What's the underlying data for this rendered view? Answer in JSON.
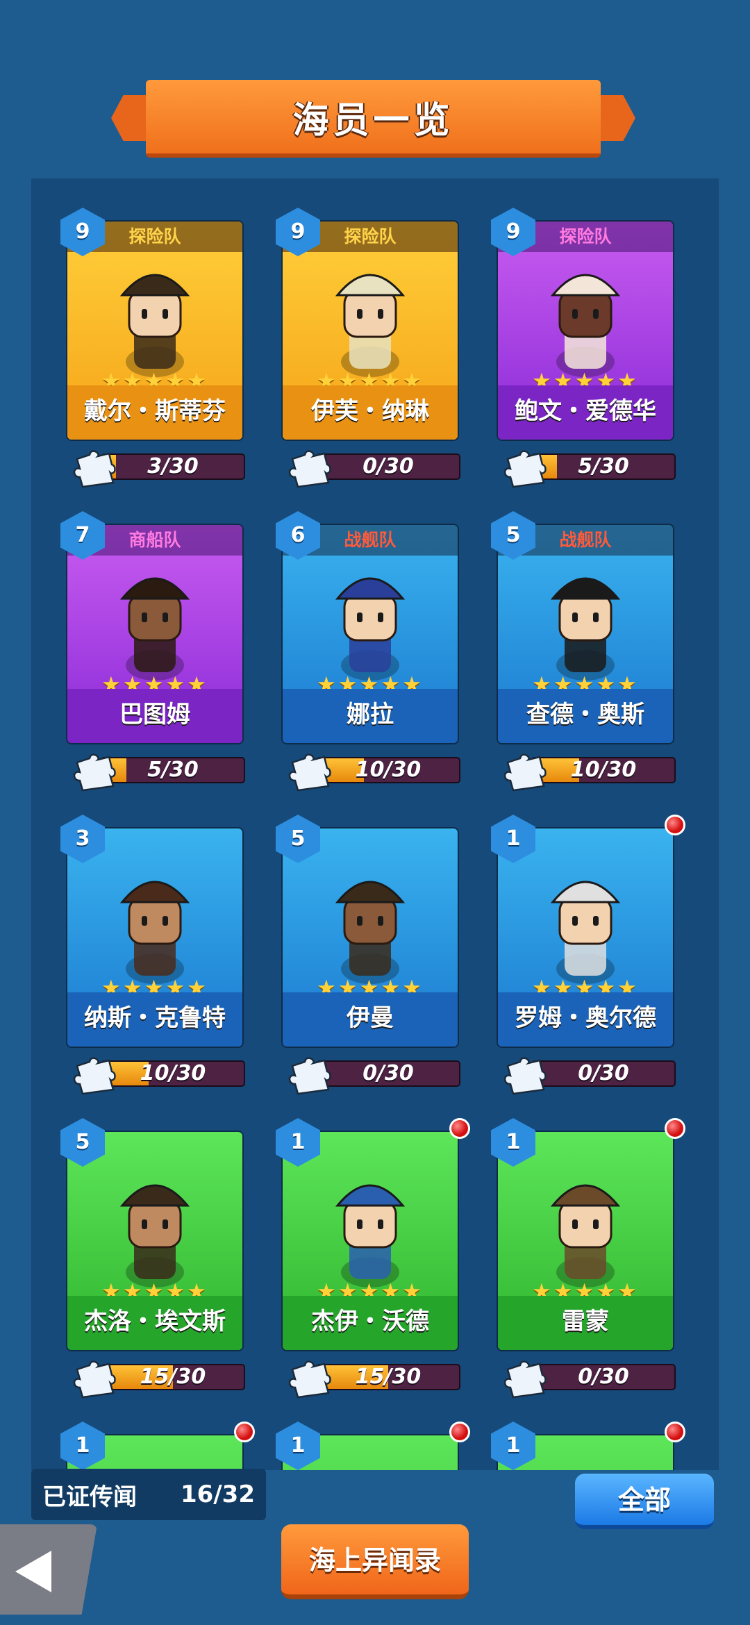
{
  "header": {
    "title": "海员一览"
  },
  "crew": [
    {
      "name": "戴尔・斯蒂芬",
      "level": "9",
      "team": "探险队",
      "progress_label": "3/30",
      "progress": 0.1,
      "color": "gold",
      "red_dot": false,
      "team_red": false,
      "hat": "#3a2a1a",
      "skin": "#f3d2b0"
    },
    {
      "name": "伊芙・纳琳",
      "level": "9",
      "team": "探险队",
      "progress_label": "0/30",
      "progress": 0.0,
      "color": "gold",
      "red_dot": false,
      "team_red": false,
      "hat": "#e8e2c0",
      "skin": "#f3d2b0"
    },
    {
      "name": "鲍文・爱德华",
      "level": "9",
      "team": "探险队",
      "progress_label": "5/30",
      "progress": 0.17,
      "color": "purple",
      "red_dot": false,
      "team_red": false,
      "hat": "#f3e6d8",
      "skin": "#6b3a2a"
    },
    {
      "name": "巴图姆",
      "level": "7",
      "team": "商船队",
      "progress_label": "5/30",
      "progress": 0.17,
      "color": "purple",
      "red_dot": false,
      "team_red": false,
      "hat": "#2a1a10",
      "skin": "#8a5a3a"
    },
    {
      "name": "娜拉",
      "level": "6",
      "team": "战舰队",
      "progress_label": "10/30",
      "progress": 0.33,
      "color": "blue",
      "red_dot": false,
      "team_red": true,
      "hat": "#2a3f9a",
      "skin": "#f3d2b0"
    },
    {
      "name": "查德・奥斯",
      "level": "5",
      "team": "战舰队",
      "progress_label": "10/30",
      "progress": 0.33,
      "color": "blue",
      "red_dot": false,
      "team_red": true,
      "hat": "#1a1a1a",
      "skin": "#f3d2b0"
    },
    {
      "name": "纳斯・克鲁特",
      "level": "3",
      "team": "",
      "progress_label": "10/30",
      "progress": 0.33,
      "color": "blue",
      "red_dot": false,
      "team_red": false,
      "hat": "#4a2a1a",
      "skin": "#c08a60"
    },
    {
      "name": "伊曼",
      "level": "5",
      "team": "",
      "progress_label": "0/30",
      "progress": 0.0,
      "color": "blue",
      "red_dot": false,
      "team_red": false,
      "hat": "#3a2a1a",
      "skin": "#8a5a3a"
    },
    {
      "name": "罗姆・奥尔德",
      "level": "1",
      "team": "",
      "progress_label": "0/30",
      "progress": 0.0,
      "color": "blue",
      "red_dot": true,
      "team_red": false,
      "hat": "#e0e0e0",
      "skin": "#f3d2b0"
    },
    {
      "name": "杰洛・埃文斯",
      "level": "5",
      "team": "",
      "progress_label": "15/30",
      "progress": 0.5,
      "color": "green",
      "red_dot": false,
      "team_red": false,
      "hat": "#3a2a1a",
      "skin": "#c08a60"
    },
    {
      "name": "杰伊・沃德",
      "level": "1",
      "team": "",
      "progress_label": "15/30",
      "progress": 0.5,
      "color": "green",
      "red_dot": true,
      "team_red": false,
      "hat": "#2a5fb0",
      "skin": "#f3d2b0"
    },
    {
      "name": "雷蒙",
      "level": "1",
      "team": "",
      "progress_label": "0/30",
      "progress": 0.0,
      "color": "green",
      "red_dot": true,
      "team_red": false,
      "hat": "#6b4a2a",
      "skin": "#f3d2b0"
    },
    {
      "name": "",
      "level": "1",
      "team": "",
      "progress_label": "",
      "progress": 0.0,
      "color": "green",
      "red_dot": true,
      "team_red": false,
      "hat": "#3a2a1a",
      "skin": "#f3d2b0"
    },
    {
      "name": "",
      "level": "1",
      "team": "",
      "progress_label": "",
      "progress": 0.0,
      "color": "green",
      "red_dot": true,
      "team_red": false,
      "hat": "#e0e0e0",
      "skin": "#f3d2b0"
    },
    {
      "name": "",
      "level": "1",
      "team": "",
      "progress_label": "",
      "progress": 0.0,
      "color": "green",
      "red_dot": true,
      "team_red": false,
      "hat": "#3a2a1a",
      "skin": "#f3d2b0"
    }
  ],
  "stars": "★★★★★",
  "footer": {
    "stat_label": "已证传闻",
    "stat_value": "16/32",
    "all_button": "全部",
    "rumor_button": "海上异闻录",
    "back_icon": "back-arrow-icon"
  }
}
